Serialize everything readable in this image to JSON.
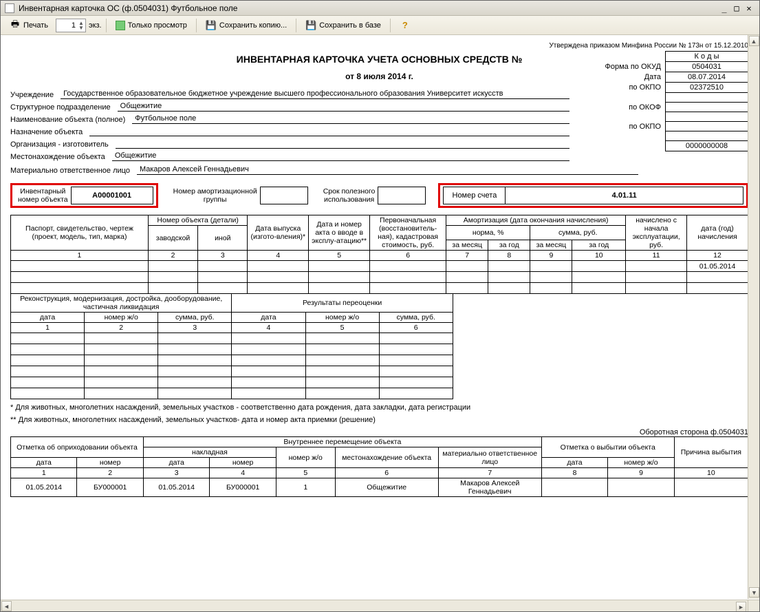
{
  "window": {
    "title": "Инвентарная карточка ОС (ф.0504031) Футбольное поле"
  },
  "toolbar": {
    "print": "Печать",
    "copies_value": "1",
    "copies_label": "экз.",
    "preview": "Только просмотр",
    "save_copy": "Сохранить копию...",
    "save_db": "Сохранить в базе"
  },
  "approval": "Утверждена приказом Минфина России  № 173н от 15.12.2010",
  "title": "ИНВЕНТАРНАЯ КАРТОЧКА УЧЕТА ОСНОВНЫХ СРЕДСТВ  №",
  "date_line": "от 8 июля 2014 г.",
  "codes": {
    "header": "К о д ы",
    "okud_label": "Форма по ОКУД",
    "okud": "0504031",
    "date_label": "Дата",
    "date": "08.07.2014",
    "okpo_label": "по ОКПО",
    "okpo": "02372510",
    "okof_label": "по ОКОФ",
    "okof": "",
    "okpo2_label": "по ОКПО",
    "okpo2": "",
    "last": "0000000008"
  },
  "info": {
    "org_label": "Учреждение",
    "org_value": "Государственное образовательное бюджетное учреждение высшего профессионального образования  Университет искусств",
    "dept_label": "Структурное подразделение",
    "dept_value": "Общежитие",
    "name_label": "Наименование объекта (полное)",
    "name_value": "Футбольное поле",
    "purpose_label": "Назначение объекта",
    "purpose_value": "",
    "maker_label": "Организация - изготовитель",
    "maker_value": "",
    "loc_label": "Местонахождение объекта",
    "loc_value": "Общежитие",
    "mol_label": "Материально ответственное лицо",
    "mol_value": "Макаров Алексей Геннадьевич"
  },
  "highlight": {
    "inv_lbl1": "Инвентарный",
    "inv_lbl2": "номер объекта",
    "inv_val": "А00001001",
    "amort_lbl1": "Номер амортизационной",
    "amort_lbl2": "группы",
    "amort_val": "",
    "life_lbl1": "Срок полезного",
    "life_lbl2": "использования",
    "life_val": "",
    "acct_lbl": "Номер счета",
    "acct_val": "4.01.11"
  },
  "table1": {
    "h_passport": "Паспорт, свидетельство, чертеж (проект, модель, тип, марка)",
    "h_objnum": "Номер объекта (детали)",
    "h_zavod": "заводской",
    "h_inoy": "иной",
    "h_daterel": "Дата выпуска (изгото-вления)*",
    "h_actnum": "Дата и номер акта о вводе в эксплу-атацию**",
    "h_initcost": "Первоначальная (восстановитель-ная), кадастровая стоимость, руб.",
    "h_amort": "Амортизация        (дата окончания начисления)",
    "h_rate": "норма, %",
    "h_sum": "сумма, руб.",
    "h_month": "за месяц",
    "h_year": "за год",
    "h_accr": "начислено с начала эксплуатации, руб.",
    "h_accrdate": "дата (год) начисления",
    "cols": [
      "1",
      "2",
      "3",
      "4",
      "5",
      "6",
      "7",
      "8",
      "9",
      "10",
      "11",
      "12"
    ],
    "row1_c12": "01.05.2014"
  },
  "table2": {
    "h_recon": "Реконструкция, модернизация, достройка, дооборудование, частичная ликвидация",
    "h_reval": "Результаты переоценки",
    "h_date": "дата",
    "h_jo": "номер ж/о",
    "h_sum": "сумма, руб.",
    "cols": [
      "1",
      "2",
      "3",
      "4",
      "5",
      "6"
    ]
  },
  "footnote1": "* Для животных, многолетних насаждений, земельных участков - соответственно дата рождения, дата закладки, дата регистрации",
  "footnote2": "** Для животных, многолетних насаждений, земельных участков- дата и номер акта приемки (решение)",
  "reverse_note": "Оборотная сторона ф.0504031",
  "table3": {
    "h_receipt": "Отметка об оприходовании объекта",
    "h_move": "Внутреннее перемещение объекта",
    "h_invoice": "накладная",
    "h_loc": "местонахождение объекта",
    "h_mol": "материально ответственное лицо",
    "h_disp": "Отметка о выбытии объекта",
    "h_reason": "Причина выбытия",
    "h_date": "дата",
    "h_num": "номер",
    "h_jo": "номер ж/о",
    "cols": [
      "1",
      "2",
      "3",
      "4",
      "5",
      "6",
      "7",
      "8",
      "9",
      "10"
    ],
    "row": {
      "c1": "01.05.2014",
      "c2": "БУ000001",
      "c3": "01.05.2014",
      "c4": "БУ000001",
      "c5": "1",
      "c6": "Общежитие",
      "c7": "Макаров Алексей Геннадьевич",
      "c8": "",
      "c9": "",
      "c10": ""
    }
  }
}
